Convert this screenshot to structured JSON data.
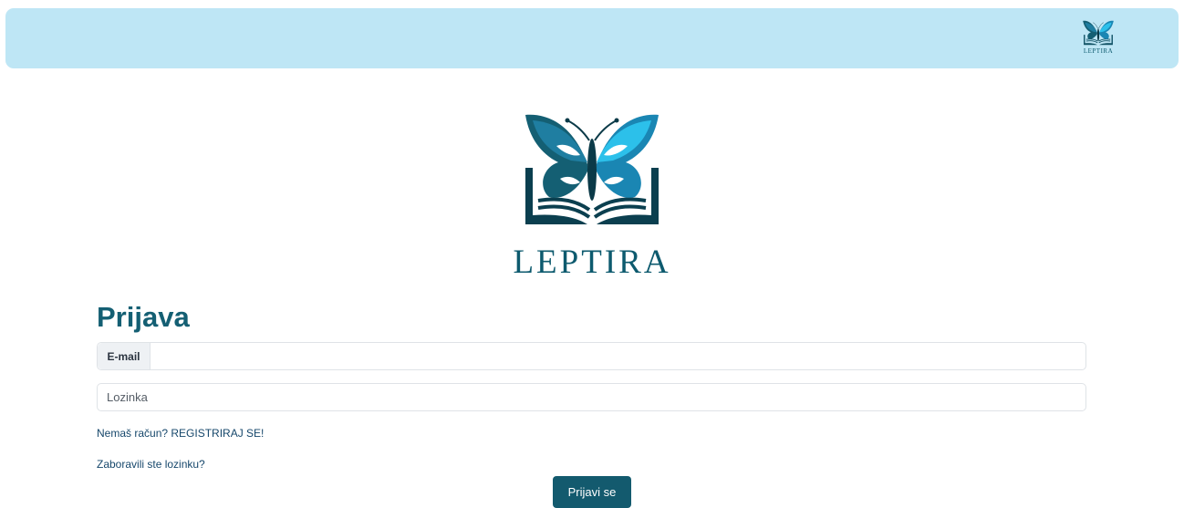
{
  "header": {
    "logo_icon": "butterfly-book-icon",
    "logo_text": "LEPTIRA",
    "background_color": "#bee6f5"
  },
  "hero": {
    "logo_icon": "butterfly-book-icon",
    "logo_text": "LEPTIRA"
  },
  "login": {
    "title": "Prijava",
    "email_label": "E-mail",
    "email_value": "",
    "password_placeholder": "Lozinka",
    "register_link": "Nemaš račun? REGISTRIRAJ SE!",
    "forgot_link": "Zaboravili ste lozinku?",
    "submit_label": "Prijavi se"
  },
  "colors": {
    "brand_dark": "#0d5a6e",
    "brand_light": "#29a9d6",
    "button": "#135a6e"
  }
}
